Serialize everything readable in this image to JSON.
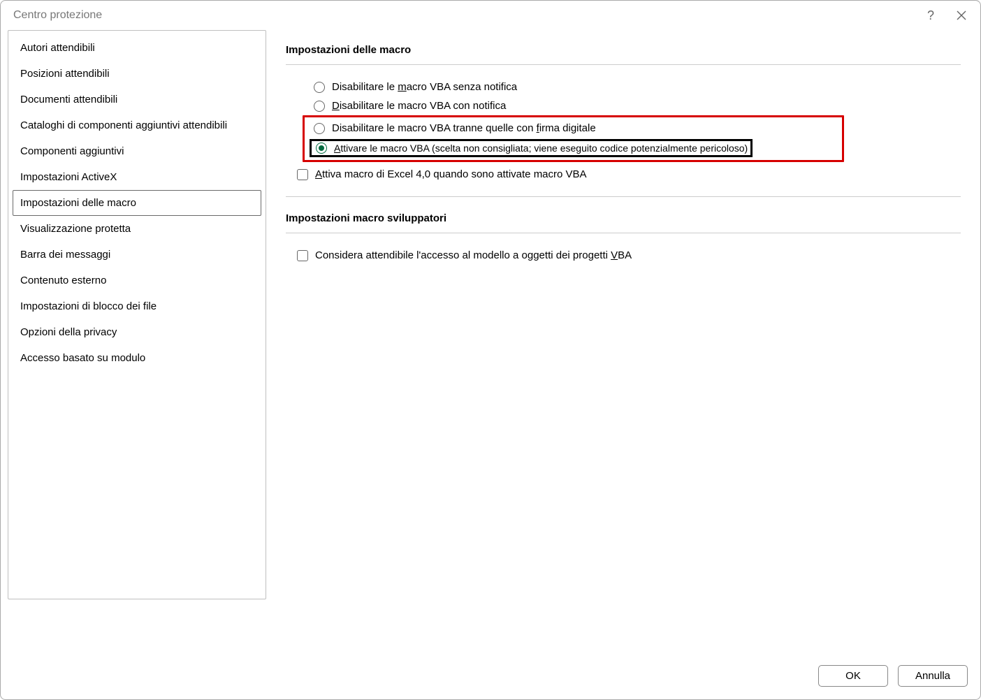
{
  "title": "Centro protezione",
  "sidebar": {
    "items": [
      {
        "label": "Autori attendibili"
      },
      {
        "label": "Posizioni attendibili"
      },
      {
        "label": "Documenti attendibili"
      },
      {
        "label": "Cataloghi di componenti aggiuntivi attendibili"
      },
      {
        "label": "Componenti aggiuntivi"
      },
      {
        "label": "Impostazioni ActiveX"
      },
      {
        "label": "Impostazioni delle macro",
        "selected": true
      },
      {
        "label": "Visualizzazione protetta"
      },
      {
        "label": "Barra dei messaggi"
      },
      {
        "label": "Contenuto esterno"
      },
      {
        "label": "Impostazioni di blocco dei file"
      },
      {
        "label": "Opzioni della privacy"
      },
      {
        "label": "Accesso basato su modulo"
      }
    ]
  },
  "macroSection": {
    "header": "Impostazioni delle macro",
    "options": [
      {
        "pre": "Disabilitare le ",
        "u": "m",
        "post": "acro VBA senza notifica",
        "selected": false
      },
      {
        "pre": "",
        "u": "D",
        "post": "isabilitare le macro VBA con notifica",
        "selected": false
      },
      {
        "pre": "Disabilitare le macro VBA tranne quelle con ",
        "u": "f",
        "post": "irma digitale",
        "selected": false
      },
      {
        "pre": "",
        "u": "A",
        "post": "ttivare le macro VBA (scelta non consigliata; viene eseguito codice potenzialmente pericoloso)",
        "selected": true
      }
    ],
    "excel4": {
      "pre": "",
      "u": "A",
      "post": "ttiva macro di Excel 4,0 quando sono attivate macro VBA"
    }
  },
  "devSection": {
    "header": "Impostazioni macro sviluppatori",
    "trustAccess": {
      "pre": "Considera attendibile l'accesso al modello a oggetti dei progetti ",
      "u": "V",
      "post": "BA"
    }
  },
  "buttons": {
    "ok": "OK",
    "cancel": "Annulla"
  }
}
